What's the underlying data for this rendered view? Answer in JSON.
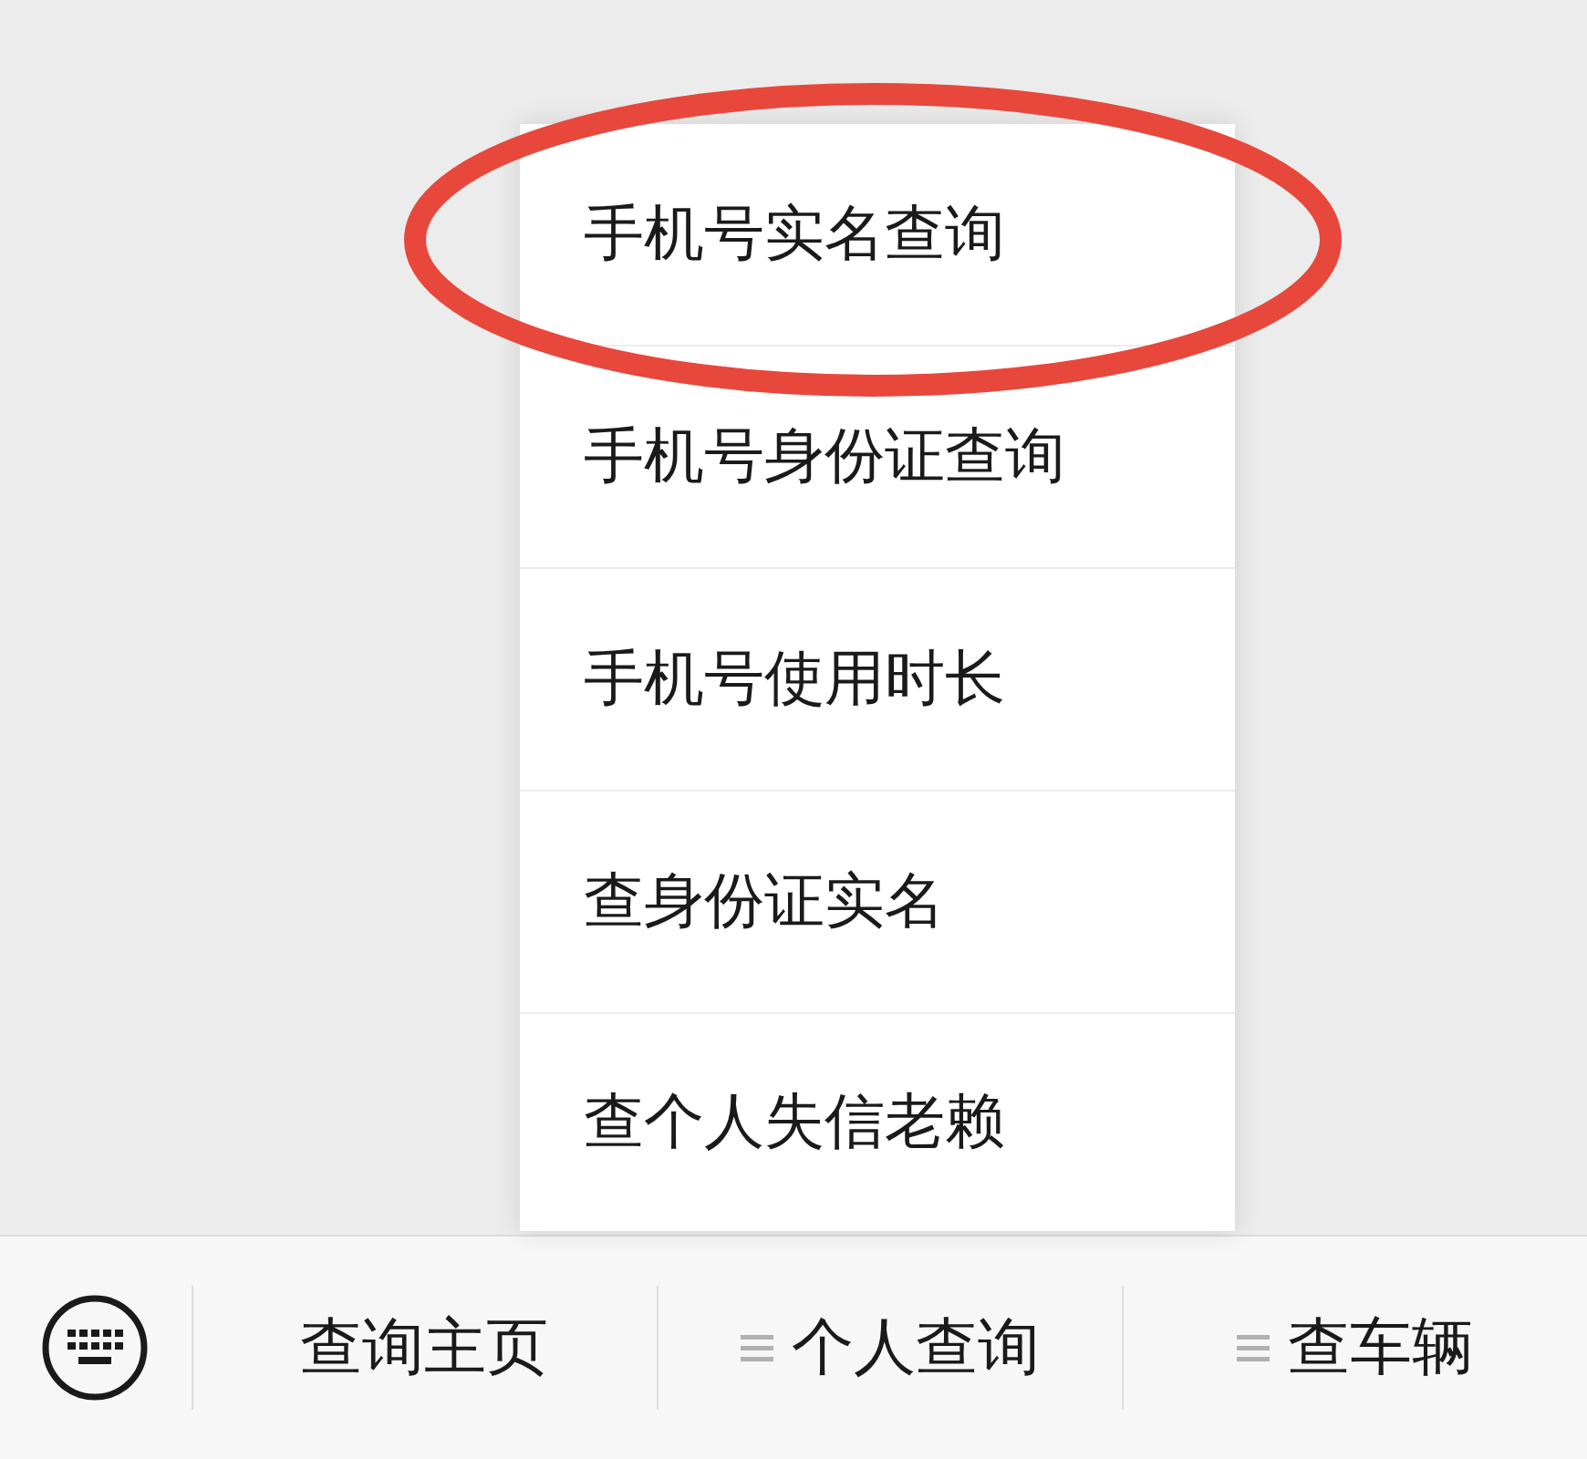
{
  "menu": {
    "items": [
      {
        "label": "手机号实名查询",
        "circled": true
      },
      {
        "label": "手机号身份证查询",
        "circled": false
      },
      {
        "label": "手机号使用时长",
        "circled": false
      },
      {
        "label": "查身份证实名",
        "circled": false
      },
      {
        "label": "查个人失信老赖",
        "circled": false
      }
    ]
  },
  "bottom_bar": {
    "tabs": [
      {
        "label": "查询主页",
        "has_submenu": false
      },
      {
        "label": "个人查询",
        "has_submenu": true
      },
      {
        "label": "查车辆",
        "has_submenu": true
      }
    ]
  }
}
